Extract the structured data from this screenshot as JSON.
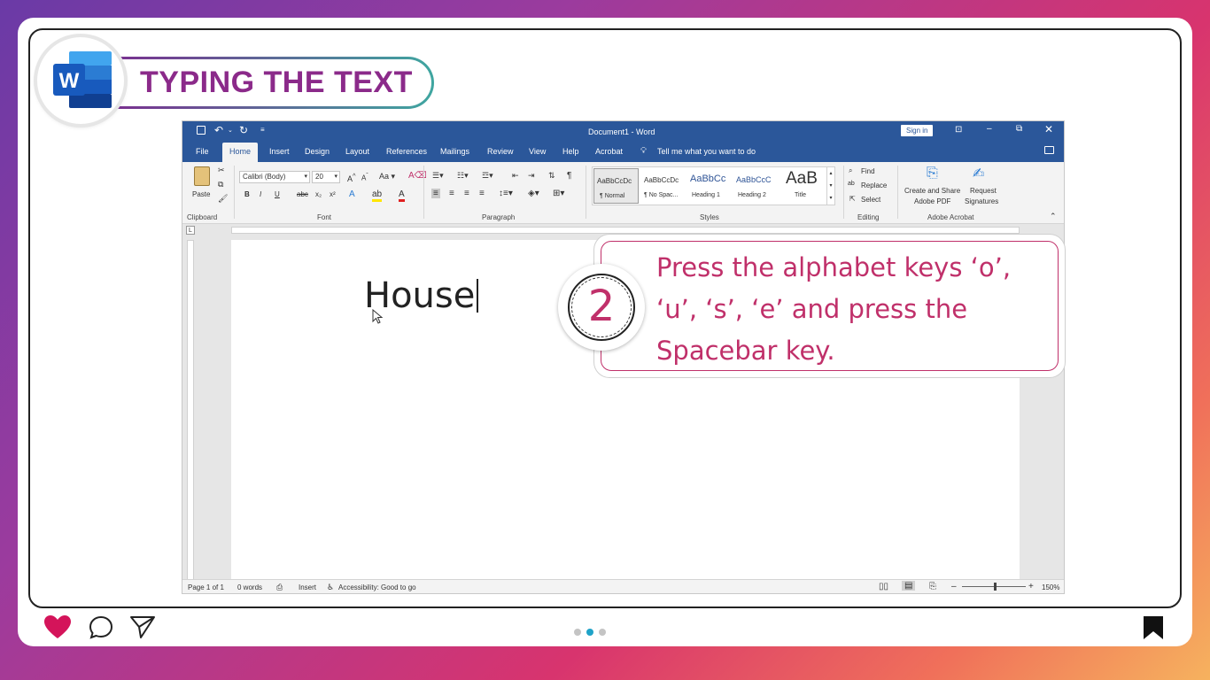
{
  "header": {
    "title": "TYPING THE TEXT",
    "logo_icon": "word-logo"
  },
  "word": {
    "titlebar": {
      "doc_title": "Document1 - Word",
      "sign_in": "Sign in"
    },
    "tabs": [
      "File",
      "Home",
      "Insert",
      "Design",
      "Layout",
      "References",
      "Mailings",
      "Review",
      "View",
      "Help",
      "Acrobat"
    ],
    "tell_me": "Tell me what you want to do",
    "ribbon": {
      "clipboard": {
        "paste": "Paste",
        "label": "Clipboard"
      },
      "font": {
        "name": "Calibri (Body)",
        "size": "20",
        "label": "Font"
      },
      "paragraph": {
        "label": "Paragraph"
      },
      "styles": {
        "items": [
          {
            "preview": "AaBbCcDc",
            "name": "¶ Normal"
          },
          {
            "preview": "AaBbCcDc",
            "name": "¶ No Spac..."
          },
          {
            "preview": "AaBbCc",
            "name": "Heading 1"
          },
          {
            "preview": "AaBbCcC",
            "name": "Heading 2"
          },
          {
            "preview": "AaB",
            "name": "Title"
          }
        ],
        "label": "Styles"
      },
      "editing": {
        "find": "Find",
        "replace": "Replace",
        "select": "Select",
        "label": "Editing"
      },
      "acrobat": {
        "create_share": "Create and Share",
        "adobe_pdf": "Adobe PDF",
        "request": "Request",
        "signatures": "Signatures",
        "label": "Adobe Acrobat"
      }
    },
    "document": {
      "text": "House"
    },
    "status": {
      "page": "Page 1 of 1",
      "words": "0 words",
      "mode": "Insert",
      "accessibility": "Accessibility: Good to go",
      "zoom": "150%"
    }
  },
  "callout": {
    "step": "2",
    "text": "Press the alphabet keys ‘o’, ‘u’, ‘s’, ‘e’ and press the Spacebar key."
  },
  "footer": {
    "carousel_count": 3,
    "active_index": 1
  }
}
